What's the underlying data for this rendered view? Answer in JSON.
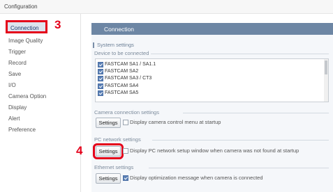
{
  "window": {
    "title": "Configuration"
  },
  "sidebar": {
    "items": [
      {
        "label": "Connection"
      },
      {
        "label": "Image Quality"
      },
      {
        "label": "Trigger"
      },
      {
        "label": "Record"
      },
      {
        "label": "Save"
      },
      {
        "label": "I/O"
      },
      {
        "label": "Camera Option"
      },
      {
        "label": "Display"
      },
      {
        "label": "Alert"
      },
      {
        "label": "Preference"
      }
    ],
    "selected": "Connection"
  },
  "annotations": {
    "step3": "3",
    "step4": "4",
    "color": "#e4001a"
  },
  "main": {
    "header": "Connection",
    "system_settings_title": "System settings",
    "device_group_title": "Device to be connected",
    "devices": [
      {
        "label": "FASTCAM SA1 / SA1.1",
        "checked": true
      },
      {
        "label": "FASTCAM SA2",
        "checked": true
      },
      {
        "label": "FASTCAM SA3 / CT3",
        "checked": true
      },
      {
        "label": "FASTCAM SA4",
        "checked": true
      },
      {
        "label": "FASTCAM SA5",
        "checked": true
      }
    ],
    "camera_connection": {
      "title": "Camera connection settings",
      "button": "Settings",
      "option": "Display camera control menu at startup",
      "checked": false
    },
    "pc_network": {
      "title": "PC network settings",
      "button": "Settings",
      "option": "Display PC network setup window when camera was not found at startup",
      "checked": false
    },
    "ethernet": {
      "title": "Ethernet settings",
      "button": "Settings",
      "option": "Display optimization message when camera is connected",
      "checked": true
    }
  },
  "colors": {
    "header_bg": "#6d86a4",
    "checkbox": "#5a7fb5",
    "selected_bg": "#dde4ee"
  }
}
